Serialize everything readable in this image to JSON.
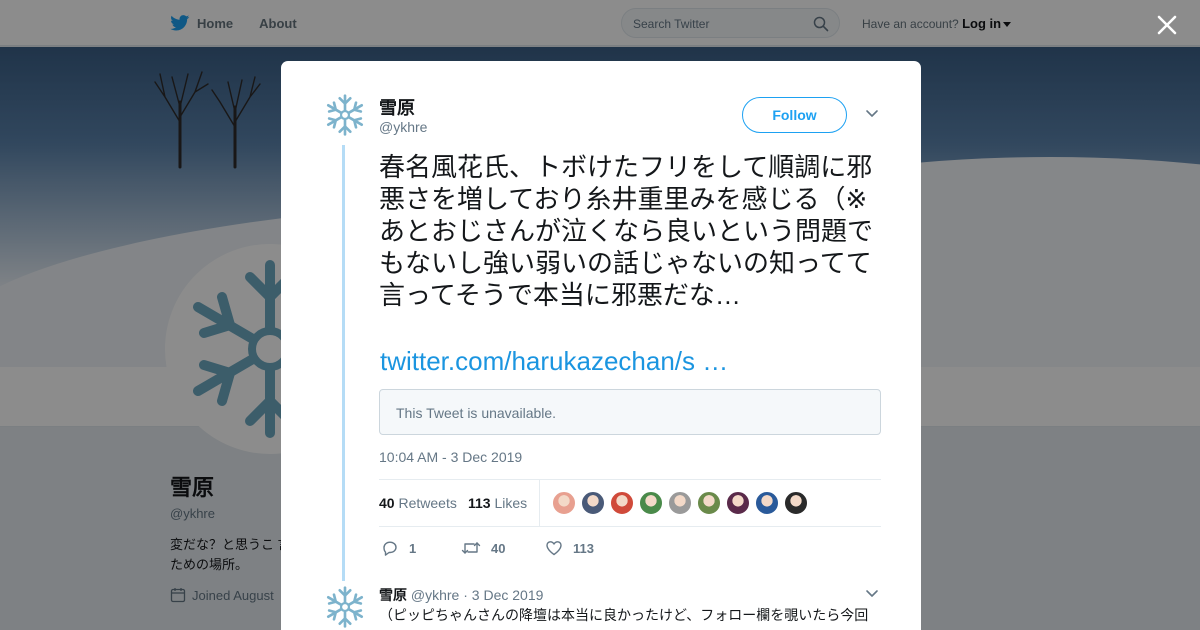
{
  "nav": {
    "home_label": "Home",
    "about_label": "About"
  },
  "search": {
    "placeholder": "Search Twitter"
  },
  "account": {
    "prompt": "Have an account?",
    "login_label": "Log in"
  },
  "profile": {
    "name": "雪原",
    "handle": "@ykhre",
    "bio": "変だな？と思うこ 言うための場所。",
    "joined": "Joined August"
  },
  "tweet": {
    "author_name": "雪原",
    "author_handle": "@ykhre",
    "follow_label": "Follow",
    "text": "春名風花氏、トボけたフリをして順調に邪悪さを増しており糸井重里みを感じる（※あとおじさんが泣くなら良いという問題でもないし強い弱いの話じゃないの知ってて言ってそうで本当に邪悪だな…",
    "link": "twitter.com/harukazechan/s …",
    "quoted_unavailable": "This Tweet is unavailable.",
    "timestamp": "10:04 AM - 3 Dec 2019",
    "retweets_count": "40",
    "retweets_label": "Retweets",
    "likes_count": "113",
    "likes_label": "Likes",
    "reply_count": "1",
    "retweet_action_count": "40",
    "like_action_count": "113"
  },
  "reply": {
    "author_name": "雪原",
    "author_handle": "@ykhre",
    "date": "· 3 Dec 2019",
    "text": "（ピッピちゃんさんの降壇は本当に良かったけど、フォロー欄を覗いたら今回"
  },
  "colors": {
    "brand_blue": "#1da1f2",
    "link_blue": "#1b95e0",
    "snowflake": "#7db3cc",
    "thread_line": "#b5dcf6"
  },
  "liker_avatars": [
    {
      "icon": "liker-avatar-1",
      "color": "#e8a090"
    },
    {
      "icon": "liker-avatar-2",
      "color": "#4a5a78"
    },
    {
      "icon": "liker-avatar-3",
      "color": "#d04a3a"
    },
    {
      "icon": "liker-avatar-4",
      "color": "#4a8a4a"
    },
    {
      "icon": "liker-avatar-5",
      "color": "#9a9a9a"
    },
    {
      "icon": "liker-avatar-6",
      "color": "#6a8a4a"
    },
    {
      "icon": "liker-avatar-7",
      "color": "#5a2a4a"
    },
    {
      "icon": "liker-avatar-8",
      "color": "#2a5a9a"
    },
    {
      "icon": "liker-avatar-9",
      "color": "#2a2a2a"
    }
  ]
}
